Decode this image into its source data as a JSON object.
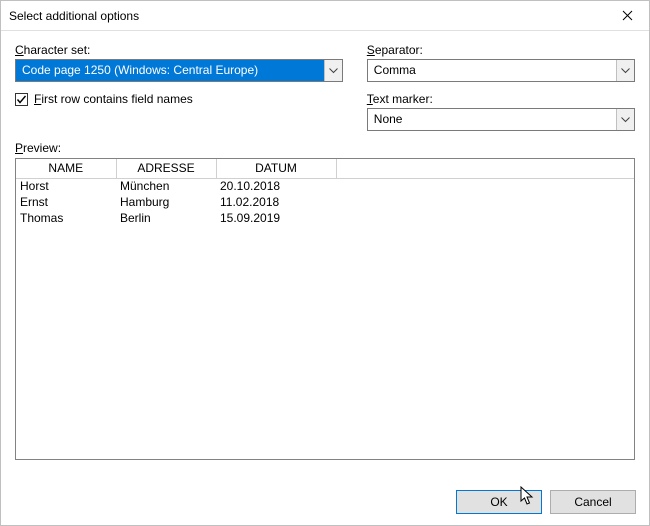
{
  "title": "Select additional options",
  "labels": {
    "character_set_pre": "",
    "character_set_key": "C",
    "character_set_post": "haracter set:",
    "separator_key": "S",
    "separator_post": "eparator:",
    "text_marker_key": "T",
    "text_marker_post": "ext marker:",
    "first_row_key": "F",
    "first_row_post": "irst row contains field names",
    "preview_key": "P",
    "preview_post": "review:"
  },
  "character_set": {
    "value": "Code page 1250 (Windows: Central Europe)"
  },
  "separator": {
    "value": "Comma"
  },
  "text_marker": {
    "value": "None"
  },
  "first_row_checked": true,
  "preview": {
    "columns": [
      "NAME",
      "ADRESSE",
      "DATUM"
    ],
    "rows": [
      {
        "name": "Horst",
        "adresse": "München",
        "datum": "20.10.2018"
      },
      {
        "name": "Ernst",
        "adresse": "Hamburg",
        "datum": "11.02.2018"
      },
      {
        "name": "Thomas",
        "adresse": "Berlin",
        "datum": "15.09.2019"
      }
    ]
  },
  "buttons": {
    "ok": "OK",
    "cancel": "Cancel"
  }
}
